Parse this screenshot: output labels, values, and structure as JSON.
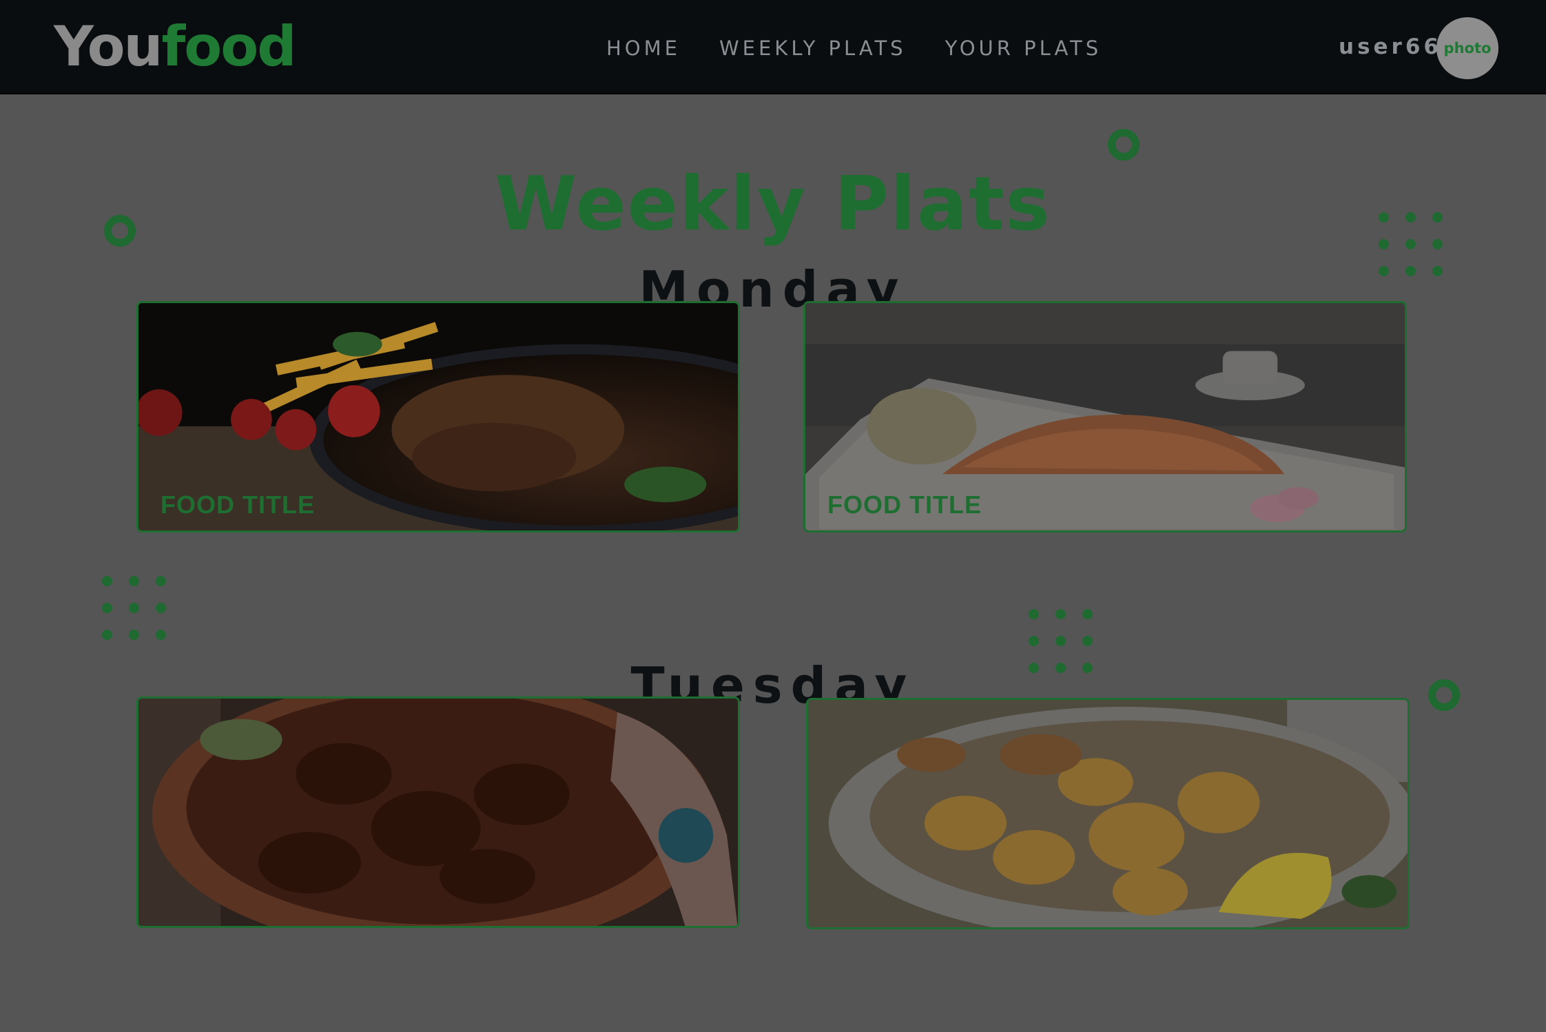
{
  "brand": {
    "you": "You",
    "food": "food"
  },
  "nav": {
    "links": [
      {
        "label": "HOME"
      },
      {
        "label": "WEEKLY PLATS"
      },
      {
        "label": "YOUR PLATS"
      }
    ]
  },
  "user": {
    "name": "user66",
    "photo_label": "photo"
  },
  "page": {
    "title": "Weekly Plats"
  },
  "days": [
    {
      "name": "Monday",
      "cards": [
        {
          "title": "FOOD TITLE",
          "image": "steak-fries-tomatoes-photo"
        },
        {
          "title": "FOOD TITLE",
          "image": "salmon-plate-photo"
        }
      ]
    },
    {
      "name": "Tuesday",
      "cards": [
        {
          "title": "",
          "image": "fried-meat-bowl-photo"
        },
        {
          "title": "",
          "image": "fried-calamari-lemon-photo"
        }
      ]
    }
  ],
  "colors": {
    "accent": "#1f7a34",
    "navbar": "#0a0d10",
    "overlay_bg": "#555555"
  }
}
